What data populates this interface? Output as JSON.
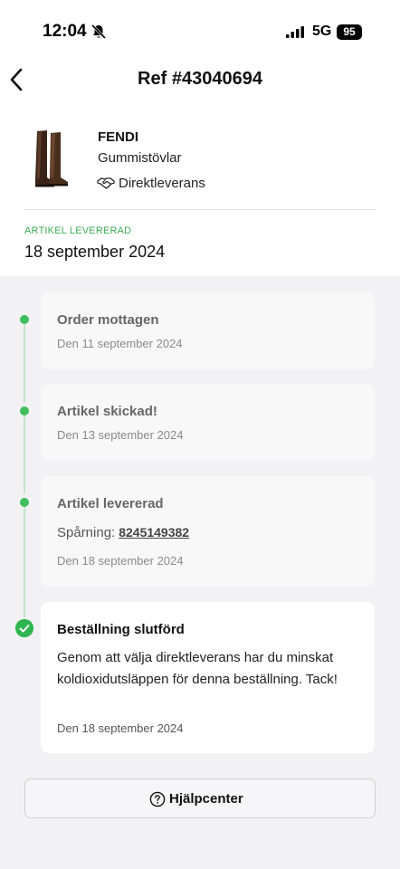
{
  "status_bar": {
    "time": "12:04",
    "network": "5G",
    "battery": "95"
  },
  "header": {
    "title": "Ref #43040694"
  },
  "product": {
    "brand": "FENDI",
    "name": "Gummistövlar",
    "shipping_label": "Direktleverans"
  },
  "status": {
    "caption": "ARTIKEL LEVERERAD",
    "date": "18 september 2024"
  },
  "timeline": [
    {
      "title": "Order mottagen",
      "date": "Den 11 september 2024"
    },
    {
      "title": "Artikel skickad!",
      "date": "Den 13 september 2024"
    },
    {
      "title": "Artikel levererad",
      "tracking_label": "Spårning:",
      "tracking_number": "8245149382",
      "date": "Den 18 september 2024"
    },
    {
      "title": "Beställning slutförd",
      "message": "Genom att välja direktleverans har du minskat koldioxidutsläppen för denna beställning. Tack!",
      "date": "Den 18 september 2024"
    }
  ],
  "footer": {
    "help_label": "Hjälpcenter"
  },
  "colors": {
    "accent_green": "#3fbf5c",
    "background": "#f2f2f4"
  }
}
